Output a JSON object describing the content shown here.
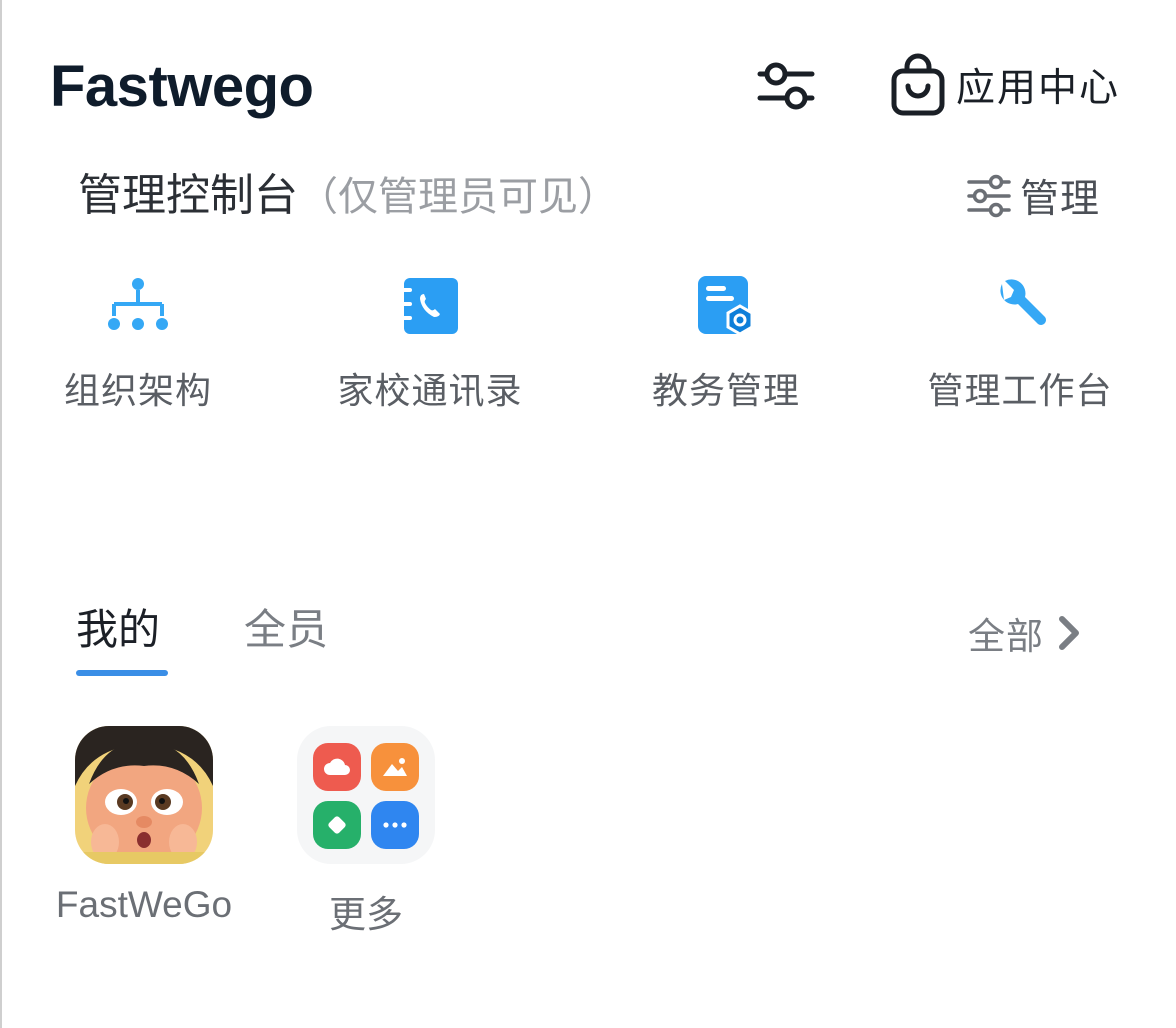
{
  "header": {
    "title": "Fastwego",
    "app_center_label": "应用中心"
  },
  "console": {
    "title": "管理控制台",
    "subtitle": "（仅管理员可见）",
    "manage_label": "管理",
    "items": [
      {
        "label": "组织架构",
        "icon": "org-chart-icon"
      },
      {
        "label": "家校通讯录",
        "icon": "contacts-icon"
      },
      {
        "label": "教务管理",
        "icon": "academic-settings-icon"
      },
      {
        "label": "管理工作台",
        "icon": "wrench-icon"
      }
    ]
  },
  "tabs": {
    "mine": "我的",
    "all_members": "全员",
    "view_all": "全部"
  },
  "apps": [
    {
      "label": "FastWeGo",
      "icon": "fastwego-avatar-icon"
    },
    {
      "label": "更多",
      "icon": "more-apps-icon"
    }
  ],
  "colors": {
    "accent": "#3a8ee6",
    "icon_blue": "#2b9ef3",
    "more_red": "#ee5b4f",
    "more_orange": "#f7913c",
    "more_green": "#26b06a",
    "more_blue": "#2f86f0"
  }
}
